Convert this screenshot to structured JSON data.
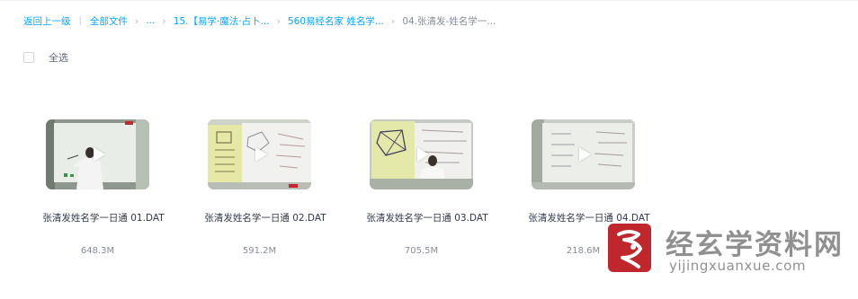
{
  "breadcrumb": {
    "back": "返回上一级",
    "all_files": "全部文件",
    "ellipsis": "...",
    "crumb1": "15.【易学·魔法·占卜...",
    "crumb2": "560易经名家 姓名学...",
    "current": "04.张清发-姓名学一..."
  },
  "toolbar": {
    "select_all": "全选"
  },
  "files": [
    {
      "name": "张清发姓名学一日通 01.DAT",
      "size": "648.3M",
      "icon": "play-icon"
    },
    {
      "name": "张清发姓名学一日通 02.DAT",
      "size": "591.2M",
      "icon": "play-icon"
    },
    {
      "name": "张清发姓名学一日通 03.DAT",
      "size": "705.5M",
      "icon": "play-icon"
    },
    {
      "name": "张清发姓名学一日通 04.DAT",
      "size": "218.6M",
      "icon": "play-icon"
    }
  ],
  "watermark": {
    "title": "经玄学资料网",
    "url": "yijingxuanxue.com"
  },
  "colors": {
    "link": "#06a7ff",
    "text_primary": "#33394a",
    "text_secondary": "#878c9c",
    "watermark_red": "#c0272d"
  }
}
